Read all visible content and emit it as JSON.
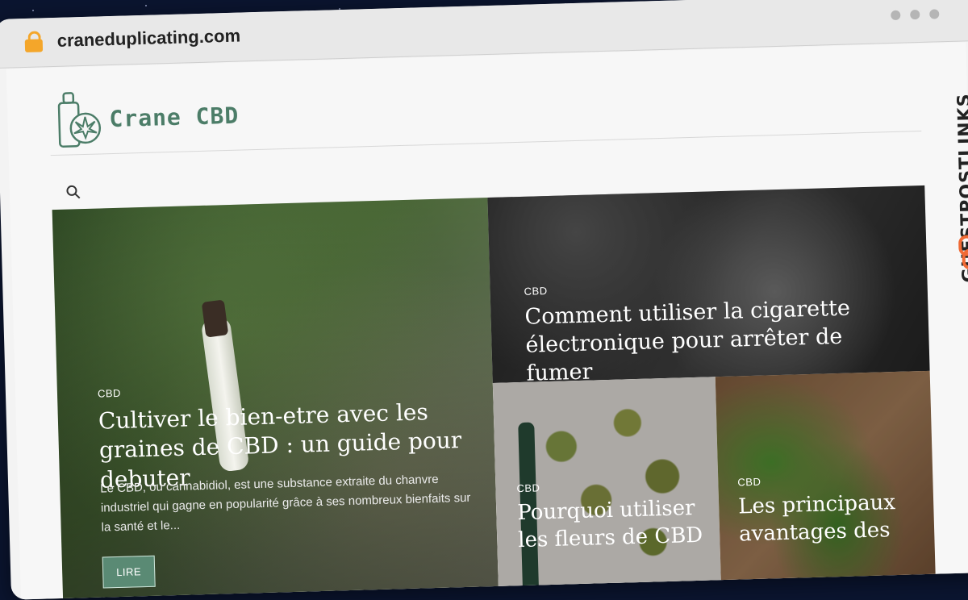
{
  "browser": {
    "url": "craneduplicating.com"
  },
  "site": {
    "name": "Crane CBD"
  },
  "banner": {
    "label": "GUESTPOSTLINKS"
  },
  "articles": [
    {
      "category": "CBD",
      "title": "Cultiver le bien-etre avec les graines de CBD : un guide pour debuter",
      "excerpt": "Le CBD, ou cannabidiol, est une substance extraite du chanvre industriel qui gagne en popularité grâce à ses nombreux bienfaits sur la santé et le...",
      "button": "LIRE"
    },
    {
      "category": "CBD",
      "title": "Comment utiliser la cigarette électronique pour arrêter de fumer"
    },
    {
      "category": "CBD",
      "title": "Pourquoi utiliser les fleurs de CBD"
    },
    {
      "category": "CBD",
      "title": "Les principaux avantages des"
    }
  ],
  "colors": {
    "accent": "#4c7d68",
    "lock": "#f4a62a",
    "banner_icon": "#f06a35"
  },
  "icons": [
    "lock-icon",
    "search-icon",
    "logo-icon",
    "link-icon"
  ]
}
